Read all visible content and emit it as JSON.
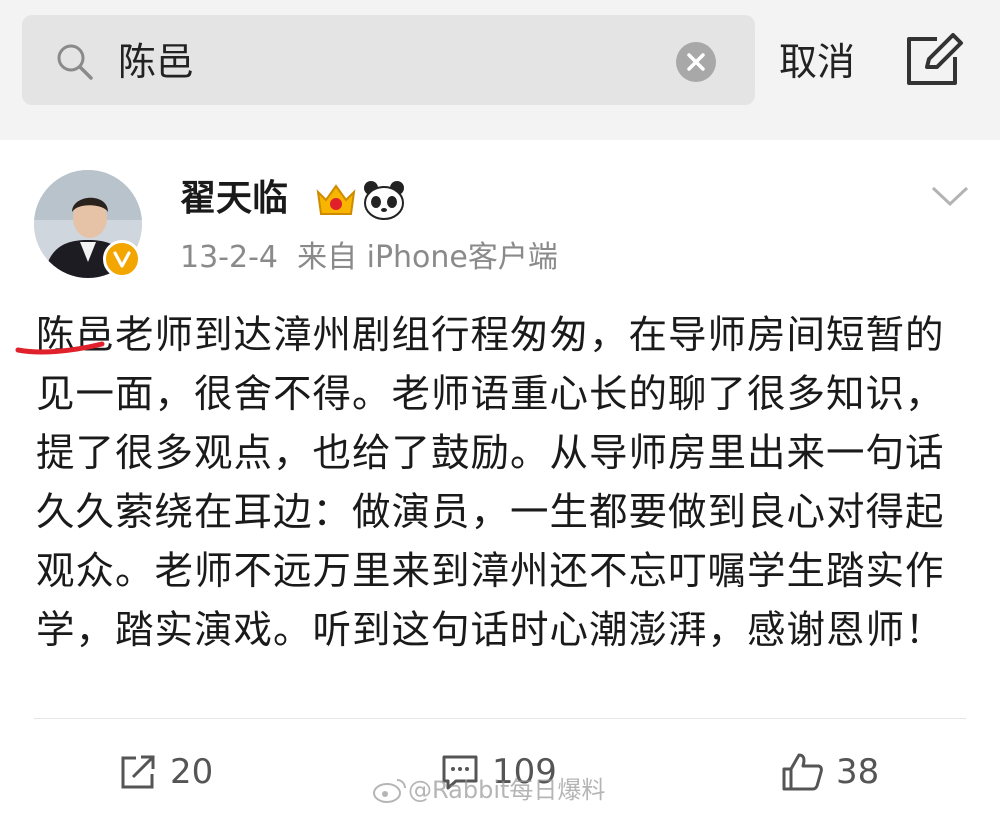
{
  "search": {
    "query": "陈邑",
    "cancel_label": "取消"
  },
  "post": {
    "author": "翟天临",
    "date": "13-2-4",
    "source": "来自 iPhone客户端",
    "highlight": "陈邑",
    "body": "老师到达漳州剧组行程匆匆，在导师房间短暂的见一面，很舍不得。老师语重心长的聊了很多知识，提了很多观点，也给了鼓励。从导师房里出来一句话久久萦绕在耳边：做演员，一生都要做到良心对得起观众。老师不远万里来到漳州还不忘叮嘱学生踏实作学，踏实演戏。听到这句话时心潮澎湃，感谢恩师！",
    "repost_count": "20",
    "comment_count": "109",
    "like_count": "38"
  },
  "watermark": "@Rabbit每日爆料",
  "icons": [
    "search-icon",
    "clear-icon",
    "compose-icon",
    "crown-icon",
    "panda-icon",
    "chevron-down-icon",
    "verified-icon",
    "repost-icon",
    "comment-icon",
    "like-icon",
    "weibo-logo-icon"
  ],
  "colors": {
    "verified": "#f3a500",
    "underline_mark": "#e0202a",
    "meta": "#8a8a8a"
  }
}
